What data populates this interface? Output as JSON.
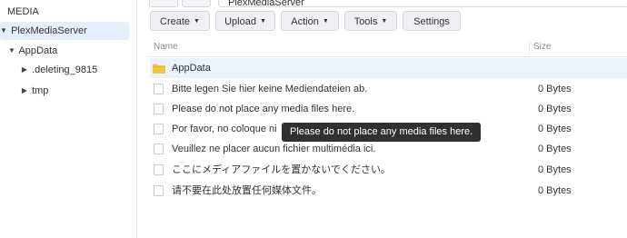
{
  "window": {
    "path": "PlexMediaServer"
  },
  "sidebar": {
    "items": [
      {
        "label": "MEDIA",
        "expanded": null,
        "selected": false
      },
      {
        "label": "PlexMediaServer",
        "expanded": true,
        "selected": true
      },
      {
        "label": "AppData",
        "expanded": true,
        "selected": false
      },
      {
        "label": ".deleting_9815",
        "expanded": false,
        "selected": false
      },
      {
        "label": "tmp",
        "expanded": false,
        "selected": false
      }
    ]
  },
  "toolbar": {
    "create": "Create",
    "upload": "Upload",
    "action": "Action",
    "tools": "Tools",
    "settings": "Settings"
  },
  "table": {
    "columns": {
      "name": "Name",
      "size": "Size"
    },
    "rows": [
      {
        "name": "AppData",
        "size": "",
        "type": "folder",
        "selected": true
      },
      {
        "name": "Bitte legen Sie hier keine Mediendateien ab.",
        "size": "0 Bytes",
        "type": "file",
        "selected": false
      },
      {
        "name": "Please do not place any media files here.",
        "size": "0 Bytes",
        "type": "file",
        "selected": false
      },
      {
        "name": "Por favor, no coloque ni",
        "size": "0 Bytes",
        "type": "file",
        "selected": false
      },
      {
        "name": "Veuillez ne placer aucun fichier multimédia ici.",
        "size": "0 Bytes",
        "type": "file",
        "selected": false
      },
      {
        "name": "ここにメディアファイルを置かないでください。",
        "size": "0 Bytes",
        "type": "file",
        "selected": false
      },
      {
        "name": "请不要在此处放置任何媒体文件。",
        "size": "0 Bytes",
        "type": "file",
        "selected": false
      }
    ]
  },
  "tooltip": {
    "text": "Please do not place any media files here."
  },
  "colors": {
    "folder": "#f5c342",
    "selected_row": "#eaf2fd",
    "tooltip_bg": "#2f3133"
  },
  "icons": {
    "folder": "folder-icon",
    "file": "file-icon",
    "collapsed": "triangle-right",
    "expanded": "triangle-down"
  }
}
